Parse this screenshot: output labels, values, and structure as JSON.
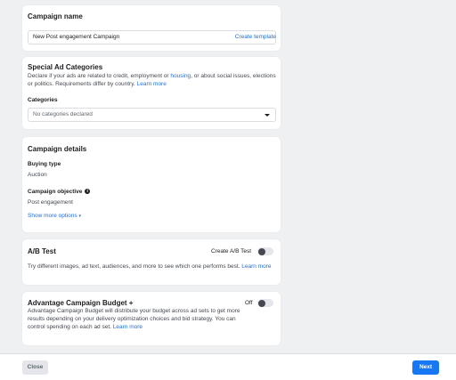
{
  "campaign_name": {
    "title": "Campaign name",
    "input_value": "New Post engagement Campaign",
    "create_template": "Create template"
  },
  "special_ad": {
    "title": "Special Ad Categories",
    "desc_part1": "Declare if your ads are related to credit, employment or ",
    "housing_link": "housing",
    "desc_part2": ", or about social issues, elections or politics. Requirements differ by country. ",
    "learn_more": "Learn more",
    "categories_label": "Categories",
    "categories_placeholder": "No categories declared"
  },
  "campaign_details": {
    "title": "Campaign details",
    "buying_type_label": "Buying type",
    "buying_type_value": "Auction",
    "objective_label": "Campaign objective",
    "objective_value": "Post engagement",
    "show_more": "Show more options"
  },
  "ab_test": {
    "title": "A/B Test",
    "toggle_label": "Create A/B Test",
    "desc": "Try different images, ad text, audiences, and more to see which one performs best. ",
    "learn_more": "Learn more"
  },
  "advantage_budget": {
    "title": "Advantage Campaign Budget +",
    "toggle_label": "Off",
    "desc": "Advantage Campaign Budget will distribute your budget across ad sets to get more results depending on your delivery optimization choices and bid strategy. You can control spending on each ad set. ",
    "learn_more": "Learn more"
  },
  "footer": {
    "close": "Close",
    "next": "Next"
  },
  "colors": {
    "link": "#216fdb",
    "primary_button": "#1877f2",
    "background": "#eff0f2"
  },
  "icons": [
    "info-icon",
    "chevron-down-icon",
    "caret-down-icon"
  ]
}
